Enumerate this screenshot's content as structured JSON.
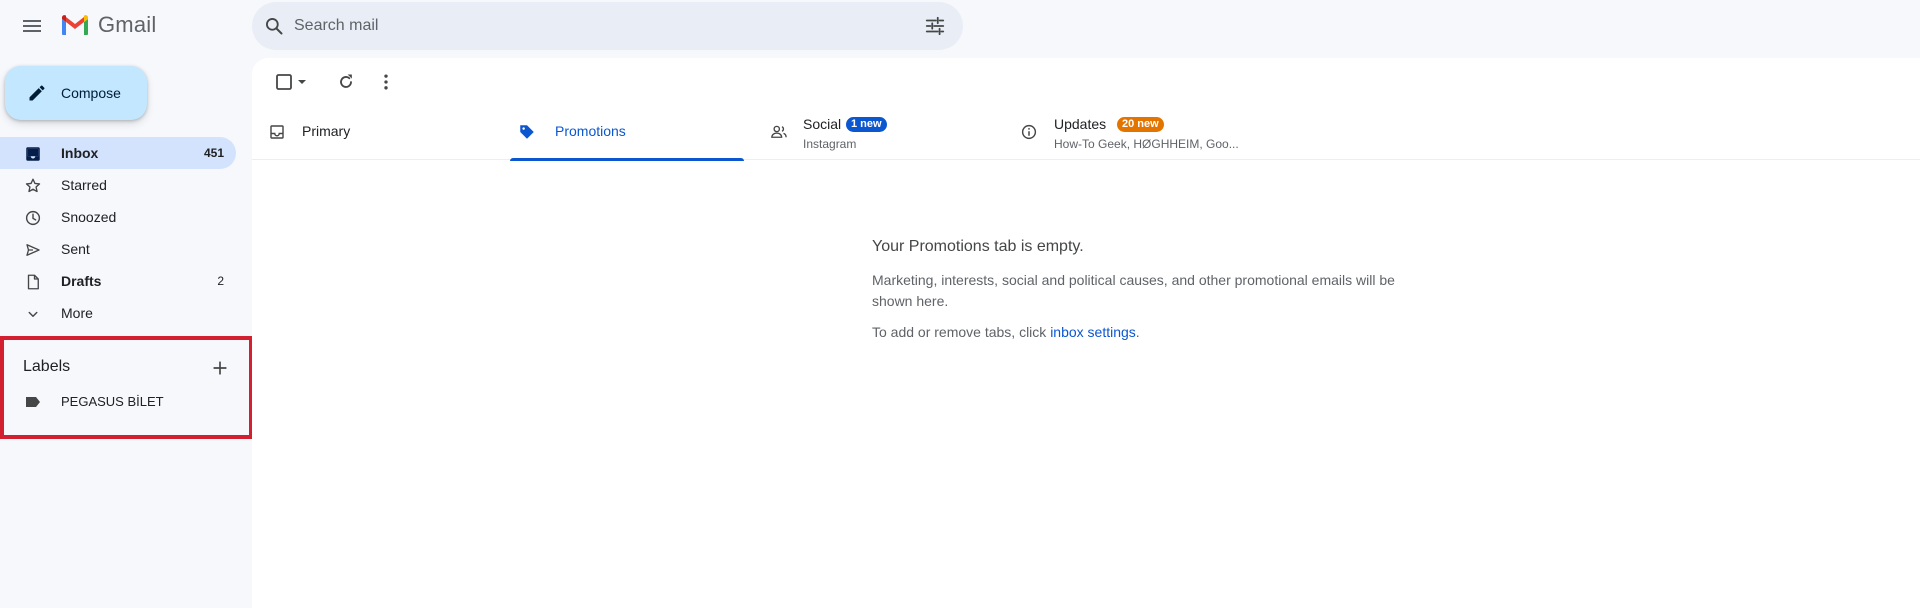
{
  "app": {
    "name": "Gmail"
  },
  "search": {
    "placeholder": "Search mail"
  },
  "compose": {
    "label": "Compose"
  },
  "nav": [
    {
      "label": "Inbox",
      "count": "451",
      "icon": "inbox-icon",
      "active": true,
      "bold": true
    },
    {
      "label": "Starred",
      "count": "",
      "icon": "star-icon"
    },
    {
      "label": "Snoozed",
      "count": "",
      "icon": "clock-icon"
    },
    {
      "label": "Sent",
      "count": "",
      "icon": "send-icon"
    },
    {
      "label": "Drafts",
      "count": "2",
      "icon": "draft-icon",
      "bold": true
    },
    {
      "label": "More",
      "count": "",
      "icon": "chevron-down-icon"
    }
  ],
  "labels": {
    "title": "Labels",
    "items": [
      {
        "label": "PEGASUS BİLET",
        "icon": "label-icon"
      }
    ]
  },
  "tabs": [
    {
      "label": "Primary",
      "icon": "inbox-tab-icon"
    },
    {
      "label": "Promotions",
      "icon": "tag-icon",
      "active": true
    },
    {
      "label": "Social",
      "icon": "people-icon",
      "badge": "1 new",
      "badge_color": "#0b57d0",
      "sub": "Instagram"
    },
    {
      "label": "Updates",
      "icon": "info-icon",
      "badge": "20 new",
      "badge_color": "#e37400",
      "sub": "How-To Geek, HØGHHEIM, Goo..."
    }
  ],
  "empty_state": {
    "title": "Your Promotions tab is empty.",
    "description": "Marketing, interests, social and political causes, and other promotional emails will be shown here.",
    "hint_prefix": "To add or remove tabs, click ",
    "hint_link": "inbox settings",
    "hint_suffix": "."
  },
  "colors": {
    "accent": "#0b57d0",
    "compose_bg": "#c2e7ff",
    "active_nav_bg": "#d3e3fd",
    "highlight_border": "#d32030",
    "updates_badge": "#e37400"
  }
}
